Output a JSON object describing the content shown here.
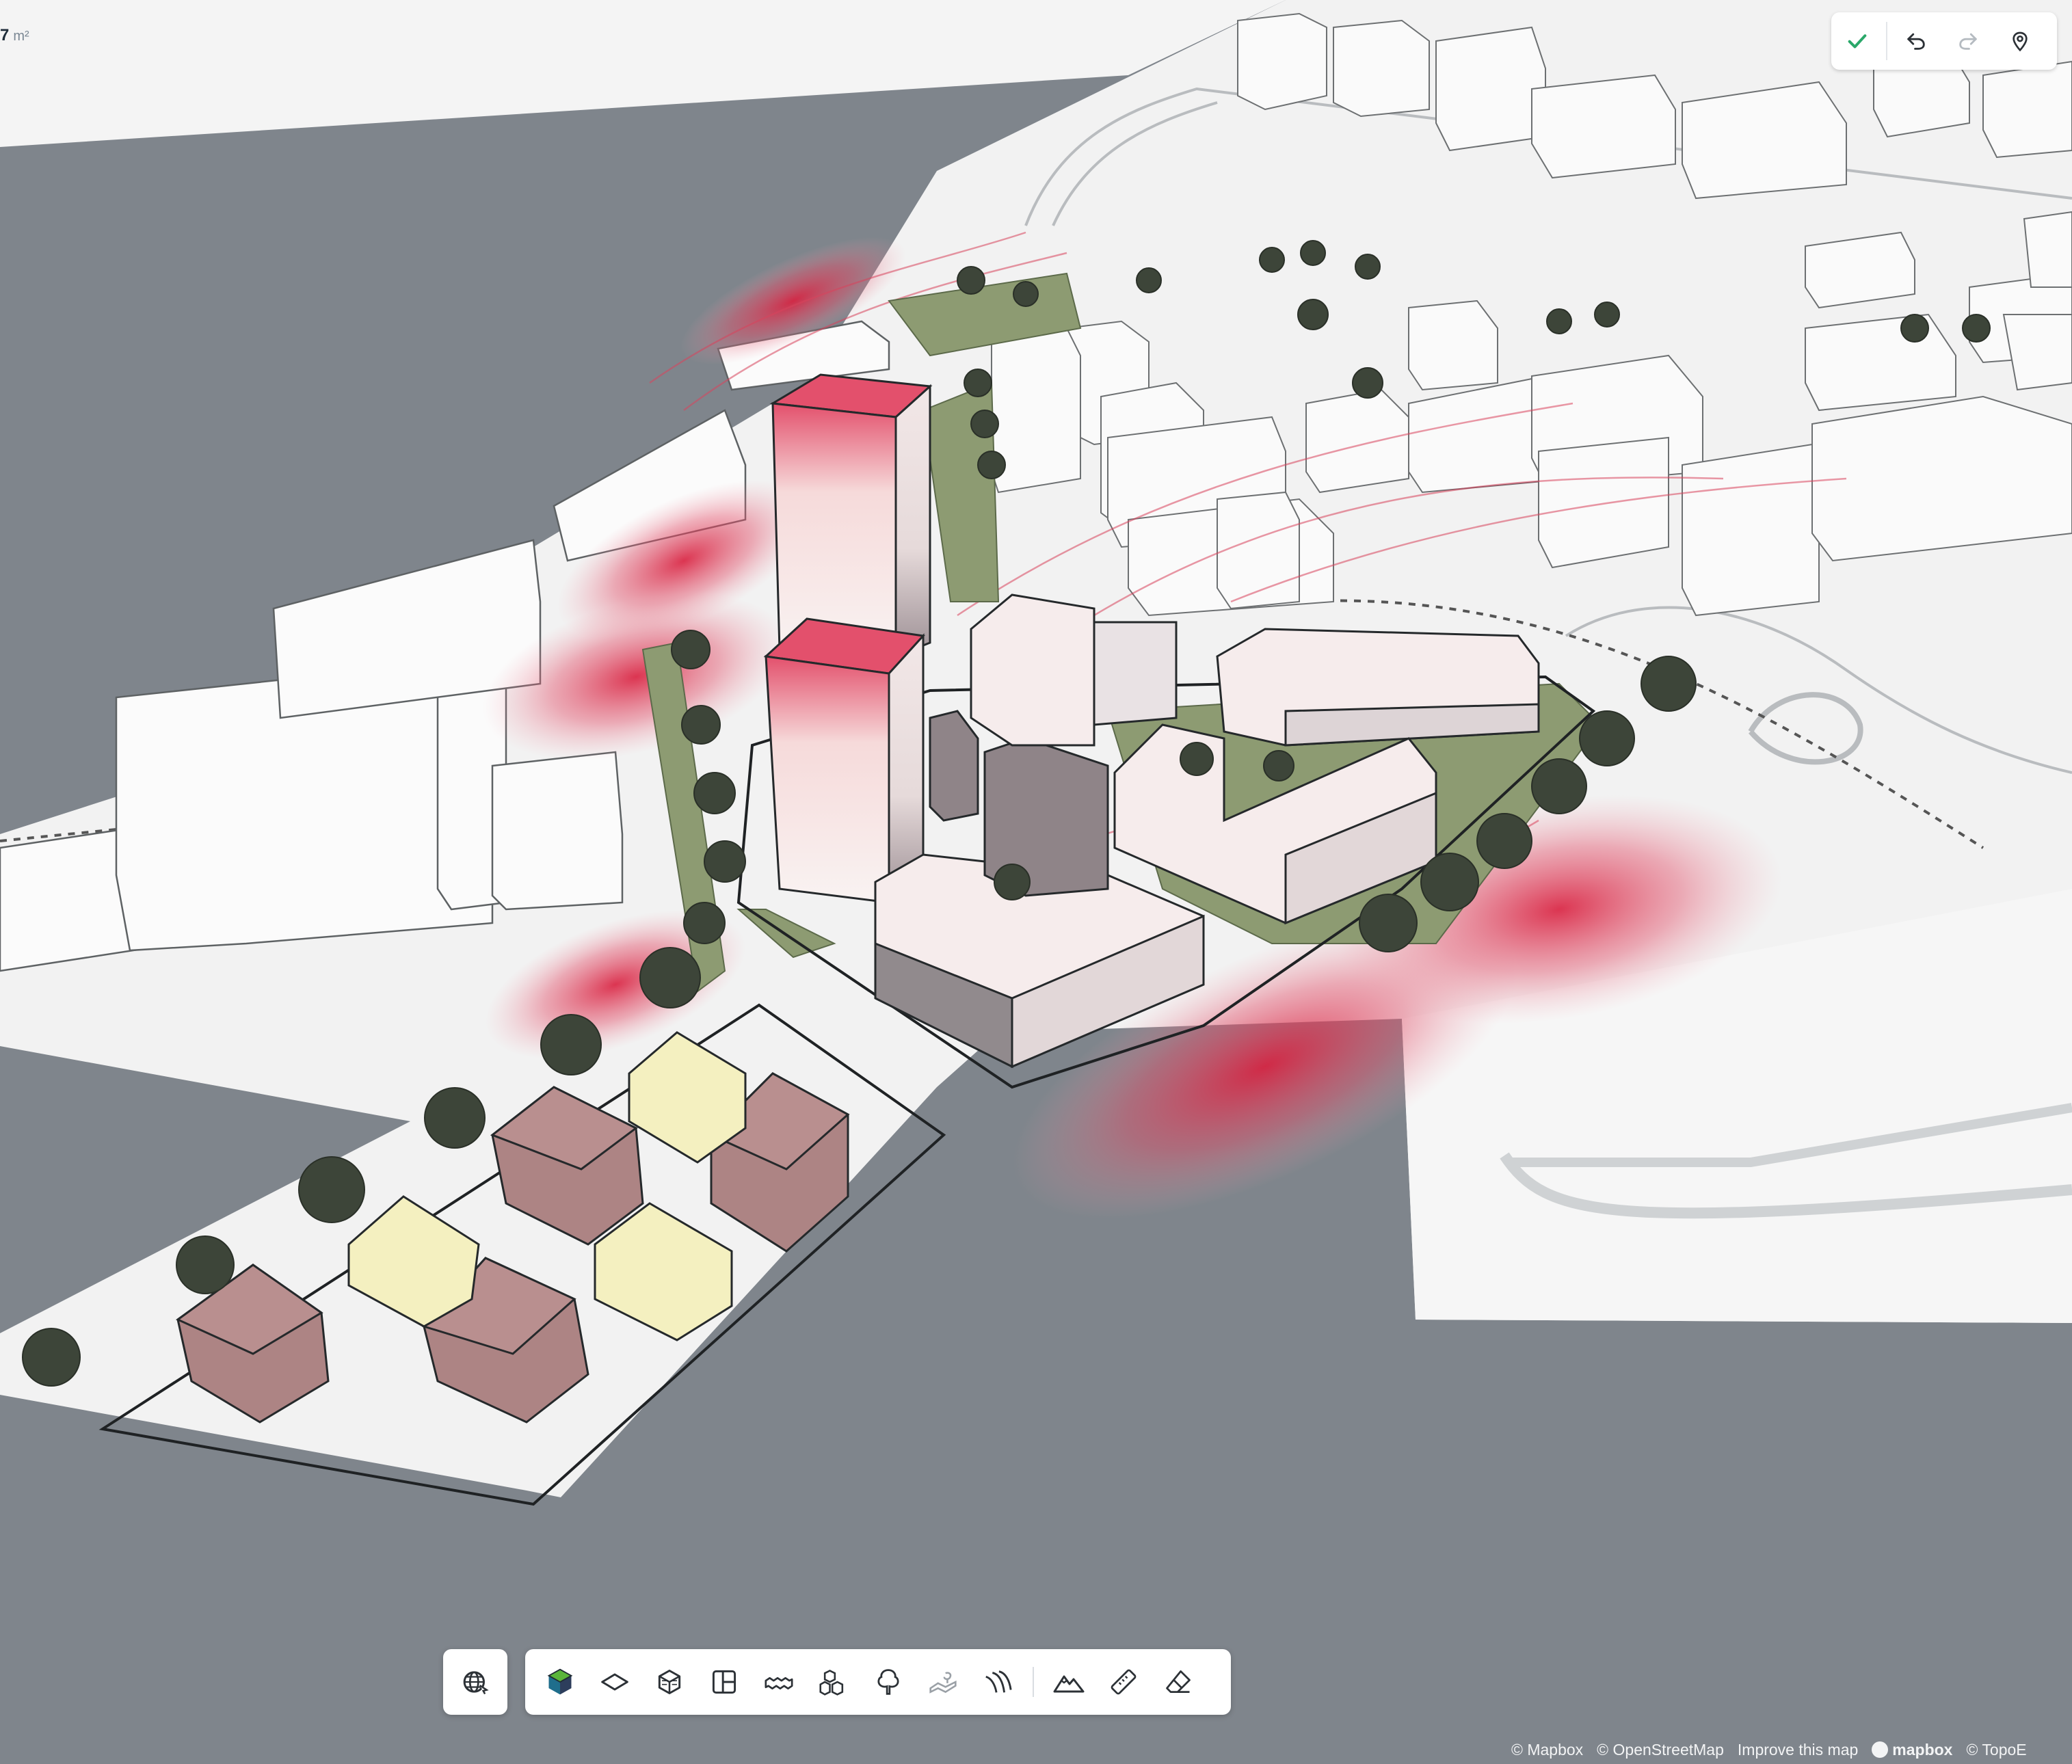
{
  "readout": {
    "value": "7",
    "unit": "m²"
  },
  "top_toolbar": {
    "confirm_icon": "check-icon",
    "undo_icon": "undo-icon",
    "redo_icon": "redo-icon",
    "location_icon": "map-pin-icon"
  },
  "bottom_toolbar": {
    "globe_icon": "globe-icon",
    "tools": [
      {
        "name": "site-analysis-tool",
        "icon": "cube-colored-icon"
      },
      {
        "name": "plot-tool",
        "icon": "plane-icon"
      },
      {
        "name": "building-tool",
        "icon": "box-icon"
      },
      {
        "name": "floorplan-tool",
        "icon": "layout-icon"
      },
      {
        "name": "rowhouse-tool",
        "icon": "rowhouses-icon"
      },
      {
        "name": "houses-tool",
        "icon": "houses-icon"
      },
      {
        "name": "tree-tool",
        "icon": "tree-icon"
      },
      {
        "name": "landscape-tool",
        "icon": "landscape-icon"
      },
      {
        "name": "wind-tool",
        "icon": "wind-lines-icon"
      },
      {
        "name": "terrain-tool",
        "icon": "mountain-icon"
      },
      {
        "name": "measure-tool",
        "icon": "ruler-icon"
      },
      {
        "name": "eraser-tool",
        "icon": "eraser-icon"
      }
    ]
  },
  "attribution": {
    "mapbox": "© Mapbox",
    "osm": "© OpenStreetMap",
    "improve": "Improve this map",
    "logo": "mapbox",
    "topo": "© TopoE"
  },
  "colors": {
    "background": "#7f858c",
    "ground": "#f4f4f4",
    "building": "#f7f7f7",
    "tree": "#3d4539",
    "grass": "#8d9b72",
    "wind": "#d92c47",
    "house_red": "#ad8484",
    "house_yellow": "#f4f0c0",
    "check": "#2aa86a"
  }
}
